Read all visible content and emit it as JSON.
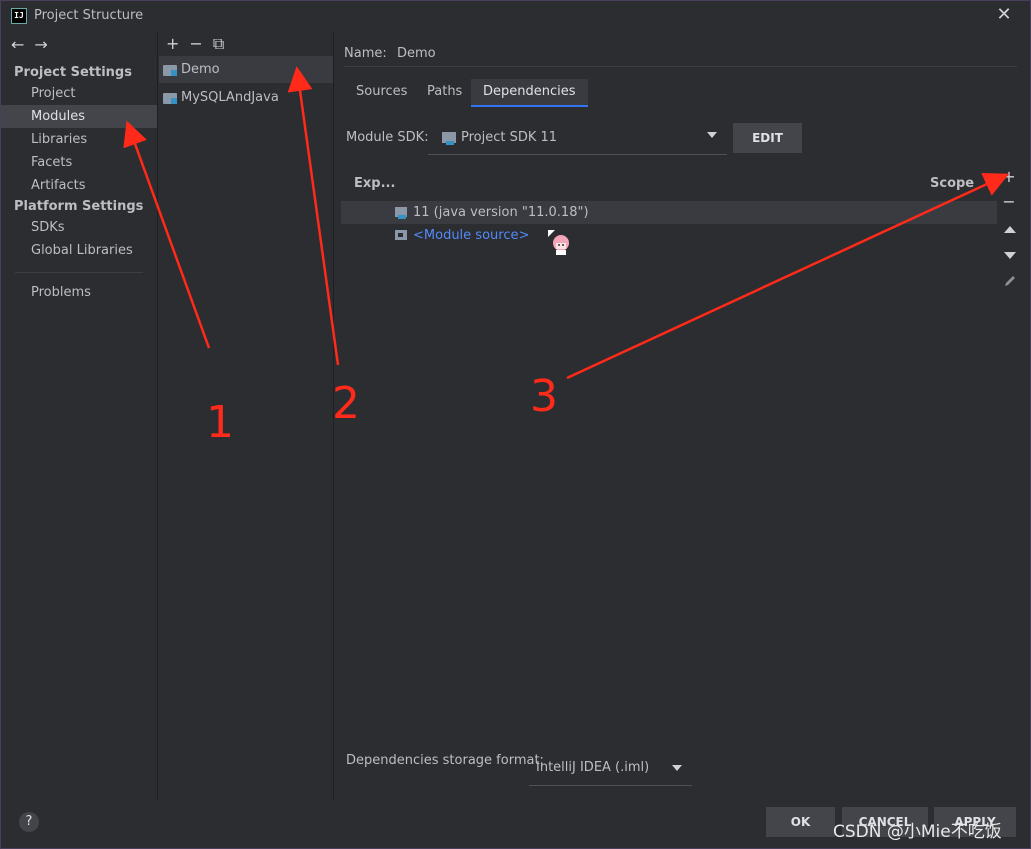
{
  "window": {
    "title": "Project Structure",
    "app_icon": "IJ"
  },
  "nav": {
    "project_settings_heading": "Project Settings",
    "project_settings_items": [
      "Project",
      "Modules",
      "Libraries",
      "Facets",
      "Artifacts"
    ],
    "platform_settings_heading": "Platform Settings",
    "platform_settings_items": [
      "SDKs",
      "Global Libraries"
    ],
    "problems": "Problems",
    "selected": "Modules"
  },
  "modules": {
    "items": [
      "Demo",
      "MySQLAndJava"
    ],
    "selected": "Demo"
  },
  "main": {
    "name_label": "Name:",
    "name_value": "Demo",
    "tabs": [
      "Sources",
      "Paths",
      "Dependencies"
    ],
    "active_tab": "Dependencies",
    "module_sdk_label": "Module SDK:",
    "module_sdk_value": "Project SDK 11",
    "edit_button": "EDIT",
    "table": {
      "col_export": "Exp...",
      "col_scope": "Scope",
      "rows": [
        "11 (java version \"11.0.18\")",
        "<Module source>"
      ]
    },
    "storage_format_label": "Dependencies storage format:",
    "storage_format_value": "IntelliJ IDEA (.iml)"
  },
  "buttons": {
    "ok": "OK",
    "cancel": "CANCEL",
    "apply": "APPLY",
    "help": "?"
  },
  "annotations": {
    "n1": "1",
    "n2": "2",
    "n3": "3"
  },
  "watermark": "CSDN @小Mie不吃饭",
  "colors": {
    "accent": "#3574f0",
    "arrow": "#ff2a1a",
    "link": "#548af7"
  }
}
